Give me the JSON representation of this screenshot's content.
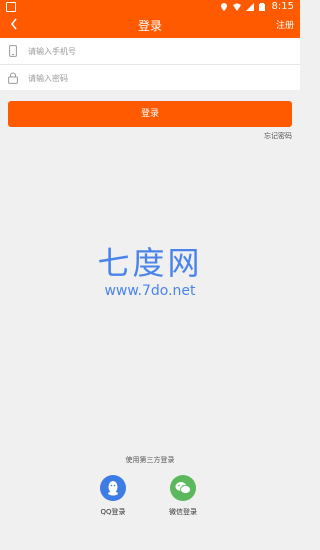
{
  "status": {
    "time": "8:15"
  },
  "appbar": {
    "title": "登录",
    "register_label": "注册"
  },
  "form": {
    "phone_placeholder": "请输入手机号",
    "password_placeholder": "请输入密码"
  },
  "login_button_label": "登录",
  "forgot_password_label": "忘记密码",
  "watermark": {
    "text": "七度网",
    "url": "www.7do.net"
  },
  "third_party": {
    "title": "使用第三方登录",
    "qq_label": "QQ登录",
    "wechat_label": "微信登录"
  },
  "colors": {
    "primary": "#ff5a00",
    "qq": "#3d7be5",
    "wechat": "#5cb85c",
    "watermark": "#4a84ea",
    "background": "#f0f0f0"
  },
  "icons": [
    "back-icon",
    "phone-icon",
    "lock-icon",
    "qq-icon",
    "wechat-icon",
    "location-icon",
    "wifi-icon",
    "signal-icon",
    "battery-icon"
  ]
}
